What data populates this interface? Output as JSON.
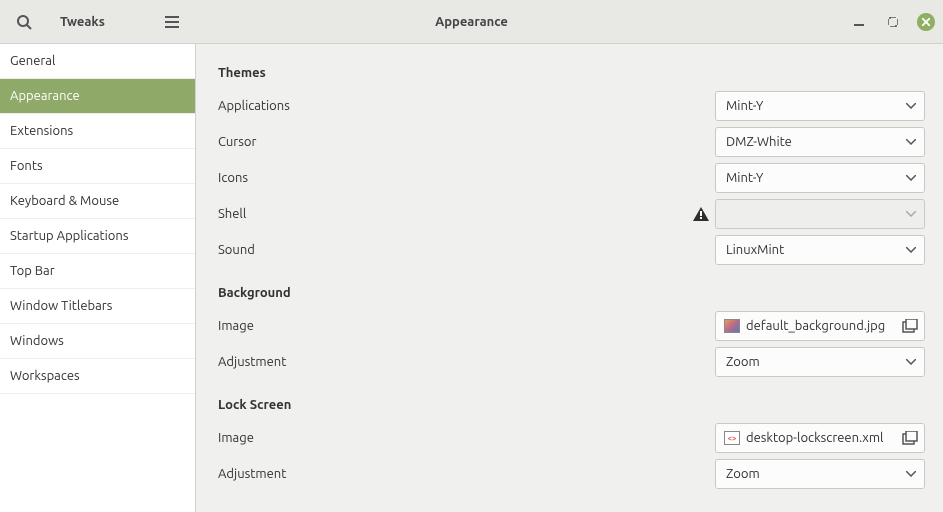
{
  "app_title": "Tweaks",
  "page_title": "Appearance",
  "sidebar": {
    "items": [
      {
        "label": "General"
      },
      {
        "label": "Appearance"
      },
      {
        "label": "Extensions"
      },
      {
        "label": "Fonts"
      },
      {
        "label": "Keyboard & Mouse"
      },
      {
        "label": "Startup Applications"
      },
      {
        "label": "Top Bar"
      },
      {
        "label": "Window Titlebars"
      },
      {
        "label": "Windows"
      },
      {
        "label": "Workspaces"
      }
    ],
    "active_index": 1
  },
  "sections": {
    "themes": {
      "title": "Themes",
      "rows": {
        "applications": {
          "label": "Applications",
          "value": "Mint-Y"
        },
        "cursor": {
          "label": "Cursor",
          "value": "DMZ-White"
        },
        "icons": {
          "label": "Icons",
          "value": "Mint-Y"
        },
        "shell": {
          "label": "Shell",
          "value": "",
          "disabled": true,
          "warning": true
        },
        "sound": {
          "label": "Sound",
          "value": "LinuxMint"
        }
      }
    },
    "background": {
      "title": "Background",
      "rows": {
        "image": {
          "label": "Image",
          "file": "default_background.jpg"
        },
        "adjustment": {
          "label": "Adjustment",
          "value": "Zoom"
        }
      }
    },
    "lockscreen": {
      "title": "Lock Screen",
      "rows": {
        "image": {
          "label": "Image",
          "file": "desktop-lockscreen.xml"
        },
        "adjustment": {
          "label": "Adjustment",
          "value": "Zoom"
        }
      }
    }
  }
}
